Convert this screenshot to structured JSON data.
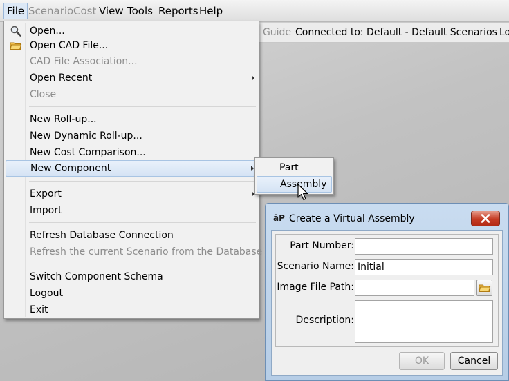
{
  "menubar": {
    "items": [
      {
        "label": "File",
        "state": "open"
      },
      {
        "label": "Scenario",
        "state": "disabled"
      },
      {
        "label": "Cost",
        "state": "disabled"
      },
      {
        "label": "View",
        "state": "enabled"
      },
      {
        "label": "Tools",
        "state": "enabled"
      },
      {
        "label": "Reports",
        "state": "enabled"
      },
      {
        "label": "Help",
        "state": "enabled"
      }
    ]
  },
  "statusbar": {
    "guide_fragment": "t Guide",
    "connected": "Connected to: Default - Default Scenarios",
    "login_fragment": "Lo"
  },
  "file_menu": {
    "items": [
      {
        "label": "Open...",
        "icon": "magnifier-icon"
      },
      {
        "label": "Open CAD File...",
        "icon": "folder-icon"
      },
      {
        "label": "CAD File Association...",
        "disabled": true
      },
      {
        "label": "Open Recent",
        "submenu": true
      },
      {
        "label": "Close",
        "disabled": true
      },
      {
        "label": "New Roll-up..."
      },
      {
        "label": "New Dynamic Roll-up..."
      },
      {
        "label": "New Cost Comparison..."
      },
      {
        "label": "New Component",
        "submenu": true,
        "highlighted": true
      },
      {
        "label": "Export",
        "submenu": true
      },
      {
        "label": "Import"
      },
      {
        "label": "Refresh Database Connection"
      },
      {
        "label": "Refresh the current Scenario from the Database",
        "disabled": true
      },
      {
        "label": "Switch Component Schema"
      },
      {
        "label": "Logout"
      },
      {
        "label": "Exit"
      }
    ]
  },
  "new_component_submenu": {
    "items": [
      {
        "label": "Part"
      },
      {
        "label": "Assembly",
        "highlighted": true
      }
    ]
  },
  "dialog": {
    "app_icon_text": "āP",
    "title": "Create a Virtual Assembly",
    "fields": {
      "part_number": {
        "label": "Part Number:",
        "value": ""
      },
      "scenario_name": {
        "label": "Scenario Name:",
        "value": "Initial"
      },
      "image_file_path": {
        "label": "Image File Path:",
        "value": ""
      },
      "description": {
        "label": "Description:",
        "value": ""
      }
    },
    "ok_label": "OK",
    "ok_enabled": false,
    "cancel_label": "Cancel"
  },
  "colors": {
    "menu_highlight": "#dce8f6",
    "dialog_frame": "#b6cde6",
    "close_button": "#c53b24",
    "disabled_text": "#8d8d8d"
  }
}
